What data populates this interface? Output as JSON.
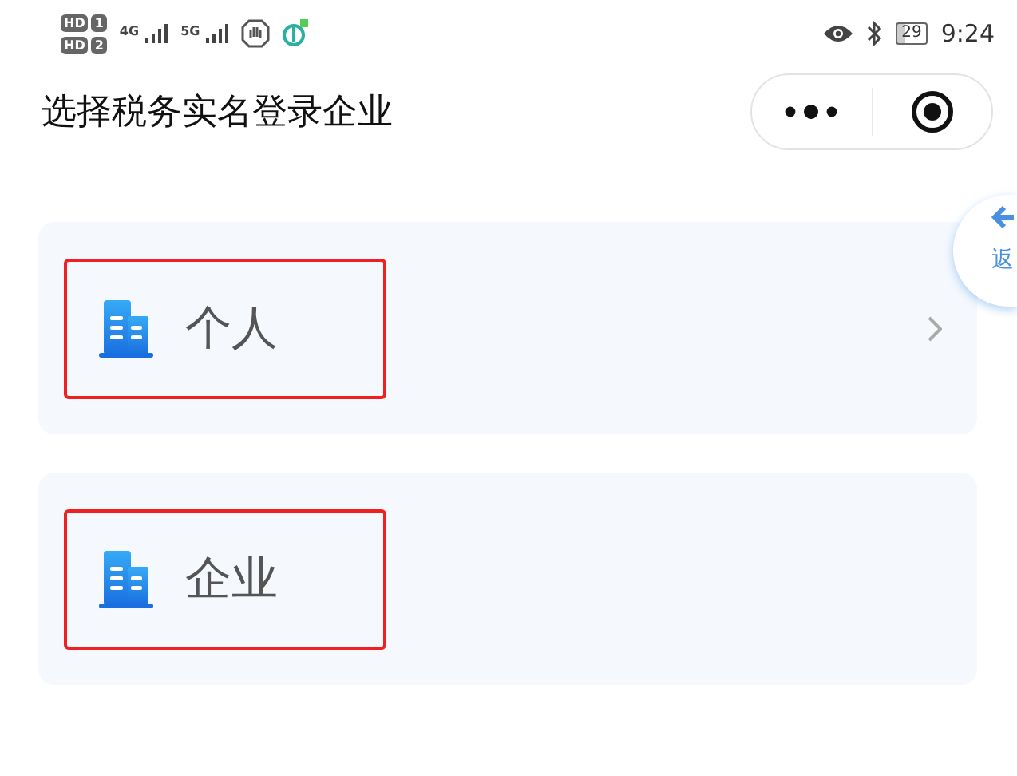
{
  "status_bar": {
    "sims": [
      {
        "badge": "HD",
        "slot": "1"
      },
      {
        "badge": "HD",
        "slot": "2"
      }
    ],
    "networks": [
      "4G",
      "5G"
    ],
    "battery": "29",
    "time": "9:24"
  },
  "header": {
    "title": "选择税务实名登录企业"
  },
  "floating_back": {
    "label": "返"
  },
  "options": [
    {
      "label": "个人",
      "highlighted": true,
      "has_chevron": true
    },
    {
      "label": "企业",
      "highlighted": true,
      "has_chevron": false
    }
  ]
}
